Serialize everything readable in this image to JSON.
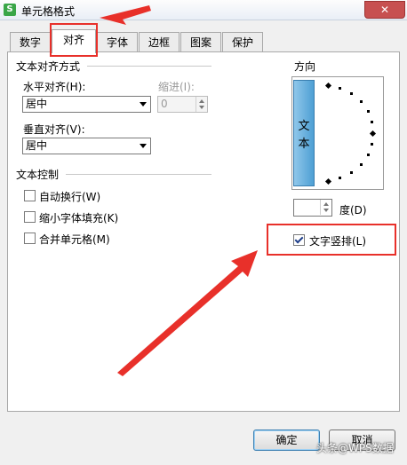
{
  "window": {
    "title": "单元格格式",
    "app_icon": "S",
    "close": "✕"
  },
  "tabs": [
    {
      "label": "数字"
    },
    {
      "label": "对齐"
    },
    {
      "label": "字体"
    },
    {
      "label": "边框"
    },
    {
      "label": "图案"
    },
    {
      "label": "保护"
    }
  ],
  "active_tab": "对齐",
  "text_align": {
    "section": "文本对齐方式",
    "horizontal_label": "水平对齐(H):",
    "horizontal_value": "居中",
    "indent_label": "缩进(I):",
    "indent_value": "0",
    "vertical_label": "垂直对齐(V):",
    "vertical_value": "居中"
  },
  "text_control": {
    "section": "文本控制",
    "wrap": "自动换行(W)",
    "shrink": "缩小字体填充(K)",
    "merge": "合并单元格(M)"
  },
  "orientation": {
    "section": "方向",
    "vertical_text_chars": [
      "文",
      "本"
    ],
    "degree_label": "度(D)",
    "vertical_checkbox": "文字竖排(L)",
    "vertical_checked": true
  },
  "buttons": {
    "ok": "确定",
    "cancel": "取消"
  },
  "watermark": "头条@WPS数据",
  "colors": {
    "highlight": "#e8302a",
    "vertical_button": "#4e9fd4",
    "app_icon": "#3aa648"
  }
}
